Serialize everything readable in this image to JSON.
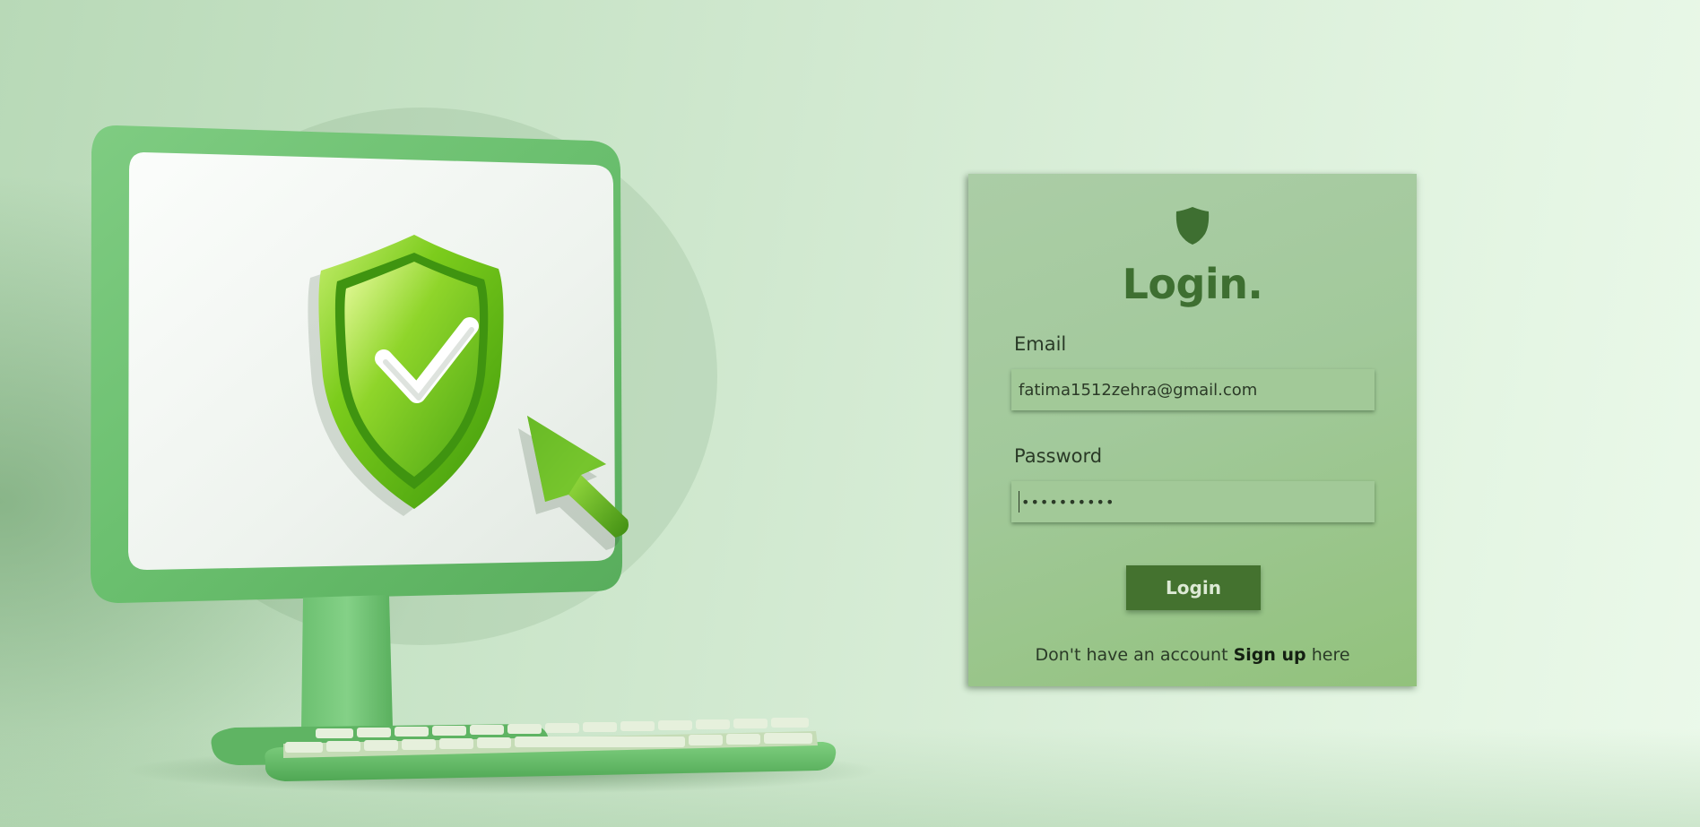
{
  "login": {
    "title": "Login.",
    "email_label": "Email",
    "email_value": "fatima1512zehra@gmail.com",
    "password_label": "Password",
    "password_value": "••••••••••",
    "button_label": "Login",
    "signup_prefix": "Don't have an account ",
    "signup_link": "Sign up",
    "signup_suffix": " here"
  },
  "icons": {
    "card_icon": "shield-icon",
    "hero": [
      "computer-monitor-icon",
      "shield-check-icon",
      "cursor-arrow-icon",
      "keyboard-icon"
    ]
  },
  "colors": {
    "accent": "#3e6f31",
    "button": "#44722f",
    "card": "#a2c99b",
    "input": "#a2c998"
  }
}
